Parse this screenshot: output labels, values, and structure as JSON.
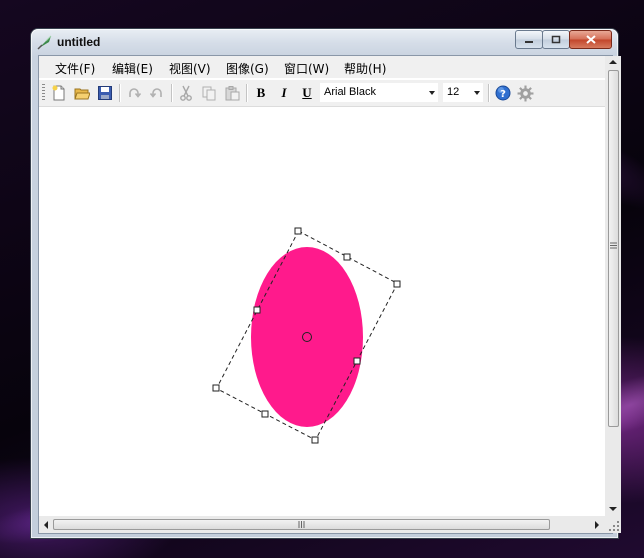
{
  "window": {
    "title": "untitled"
  },
  "menu": {
    "items": [
      "文件(F)",
      "编辑(E)",
      "视图(V)",
      "图像(G)",
      "窗口(W)",
      "帮助(H)"
    ]
  },
  "toolbar": {
    "font_name": "Arial Black",
    "font_size": "12",
    "bold_label": "B",
    "italic_label": "I",
    "underline_label": "U"
  },
  "canvas": {
    "shape": "ellipse",
    "fill_color": "#ff1a8c",
    "rotation_deg": 28,
    "selection": "dashed-rotated-box"
  },
  "colors": {
    "titlebar": "#c9d3e0",
    "accent": "#ff1a8c"
  }
}
